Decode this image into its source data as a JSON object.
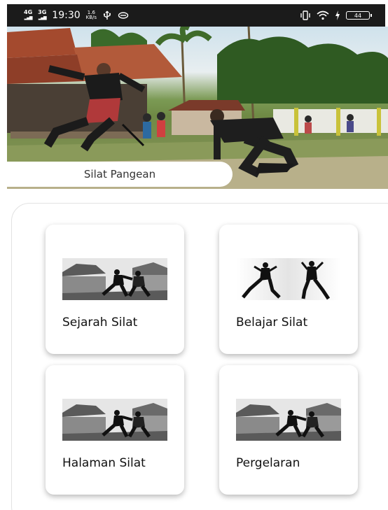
{
  "status_bar": {
    "network_1": "4G",
    "network_2": "3G",
    "time": "19:30",
    "speed_value": "1.6",
    "speed_unit": "KB/s",
    "battery": "44"
  },
  "hero": {
    "label": "Silat Pangean"
  },
  "menu": {
    "items": [
      {
        "label": "Sejarah Silat",
        "icon": "temple-fighters-image"
      },
      {
        "label": "Belajar Silat",
        "icon": "fighters-silhouette-image"
      },
      {
        "label": "Halaman Silat",
        "icon": "temple-fighters-image"
      },
      {
        "label": "Pergelaran",
        "icon": "temple-fighters-image"
      }
    ]
  }
}
